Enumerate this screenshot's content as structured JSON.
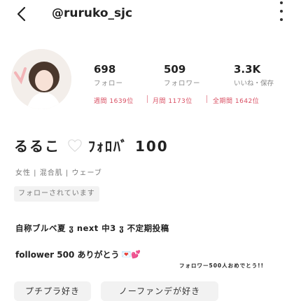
{
  "header": {
    "back_icon": "chevron-left-icon",
    "username": "@ruruko_sjc",
    "more_icon": "more-vertical-icon"
  },
  "profile": {
    "avatar_icon": "profile-avatar",
    "stats": [
      {
        "value": "698",
        "label": "フォロー"
      },
      {
        "value": "509",
        "label": "フォロワー"
      },
      {
        "value": "3.3K",
        "label": "いいね・保存"
      }
    ],
    "ranks": [
      "週間 1639位",
      "月間 1173位",
      "全期間 1642位"
    ],
    "name_part1": "るるこ",
    "name_part2": "ﾌｫﾛﾊﾞ 100",
    "heart_icon": "white-heart-icon",
    "attributes": "女性 | 混合肌 | ウェーブ",
    "follow_status": "フォローされています"
  },
  "bio": {
    "line1": "自称ブルベ夏 ჳ next 中3 ჳ 不定期投稿",
    "line2": "follower 500 ありがとう",
    "line2_emoji": "💌💕",
    "line3": "フォロワー500人おめでとう!!"
  },
  "tags": [
    "プチプラ好き",
    "ノーファンデが好き"
  ],
  "colors": {
    "accent": "#d94f63",
    "muted": "#888888",
    "chip": "#f2f2f2"
  }
}
